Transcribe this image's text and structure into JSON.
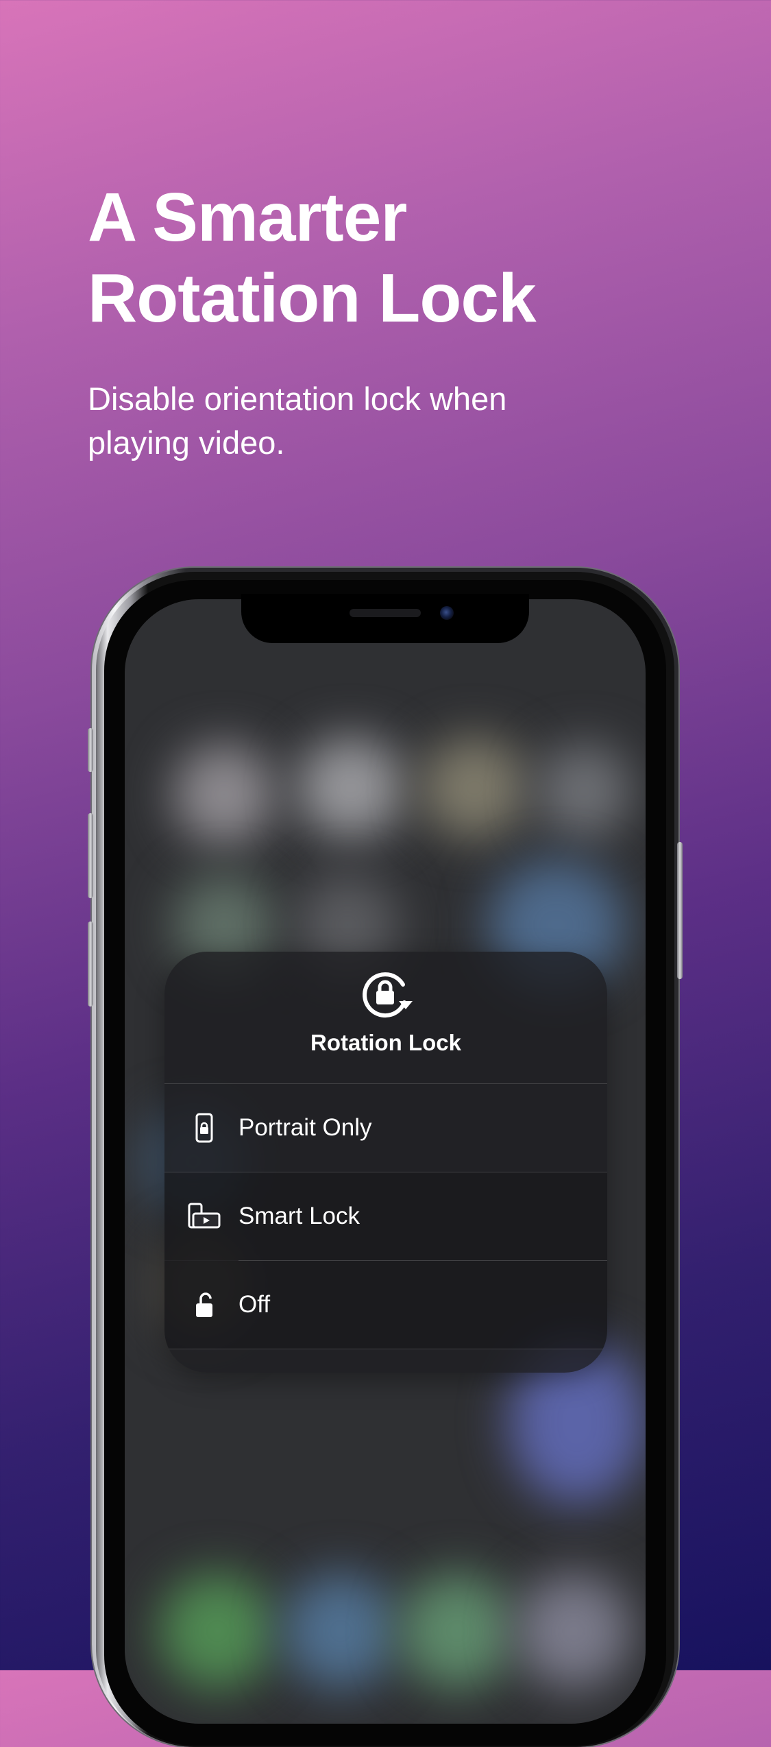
{
  "headline": {
    "line1": "A Smarter",
    "line2": "Rotation Lock"
  },
  "subhead": {
    "line1": "Disable orientation lock when",
    "line2": "playing video."
  },
  "panel": {
    "icon": "rotation-lock-icon",
    "title": "Rotation Lock",
    "options": [
      {
        "label": "Portrait Only",
        "icon": "portrait-lock-icon"
      },
      {
        "label": "Smart Lock",
        "icon": "smart-lock-icon"
      },
      {
        "label": "Off",
        "icon": "unlock-icon"
      }
    ]
  },
  "colors": {
    "gradient_top": "#d874b9",
    "gradient_bottom": "#17125e",
    "text": "#ffffff"
  }
}
